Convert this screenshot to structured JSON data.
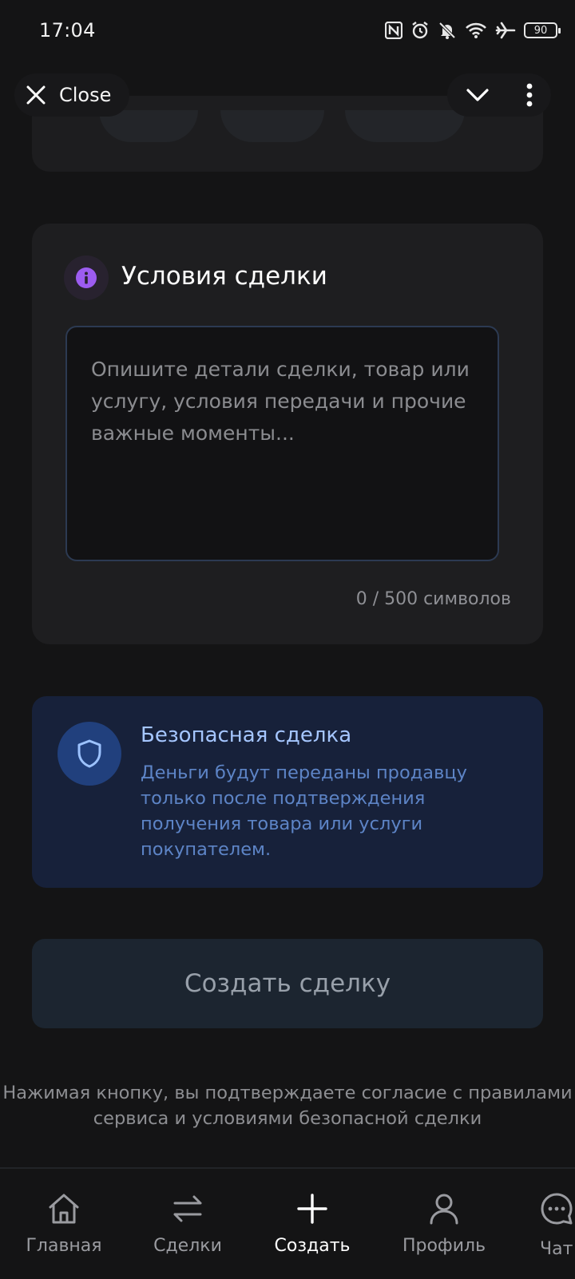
{
  "status_bar": {
    "time": "17:04",
    "battery": "90",
    "icons": [
      "nfc-icon",
      "alarm-icon",
      "bell-off-icon",
      "wifi-icon",
      "airplane-icon",
      "battery-icon"
    ]
  },
  "top_bar": {
    "close_label": "Close"
  },
  "conditions": {
    "title": "Условия сделки",
    "placeholder": "Опишите детали сделки, товар или услугу, условия передачи и прочие важные моменты...",
    "counter": "0 / 500 символов"
  },
  "safe_deal": {
    "title": "Безопасная сделка",
    "text": "Деньги будут переданы продавцу только после подтверждения получения товара или услуги покупателем."
  },
  "create_button": {
    "label": "Создать сделку"
  },
  "terms_text": "Нажимая кнопку, вы подтверждаете согласие с правилами сервиса и условиями безопасной сделки",
  "bottom_nav": {
    "items": [
      {
        "label": "Главная",
        "icon": "home-icon"
      },
      {
        "label": "Сделки",
        "icon": "swap-icon"
      },
      {
        "label": "Создать",
        "icon": "plus-icon"
      },
      {
        "label": "Профиль",
        "icon": "user-icon"
      },
      {
        "label": "Чат",
        "icon": "chat-icon"
      }
    ]
  },
  "colors": {
    "background": "#141415",
    "card": "#1e1e20",
    "accent_purple": "#9c5cf0",
    "safe_card": "#17213a",
    "safe_title": "#a5c6ff",
    "safe_text": "#5d84c6"
  }
}
